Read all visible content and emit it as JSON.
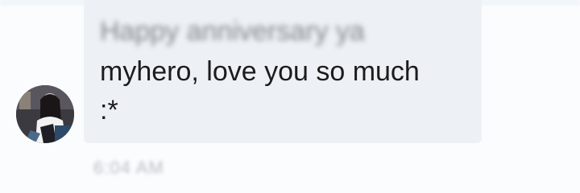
{
  "conversation": {
    "message": {
      "line1": "Happy anniversary ya",
      "line2": "myhero, love you so much",
      "line3": ":*",
      "timestamp": "6:04 AM"
    },
    "sender": {
      "avatar_icon": "profile-photo"
    }
  },
  "colors": {
    "bubble_bg": "#edf1f6",
    "text": "#1c1c1c",
    "timestamp": "#b9bec4"
  }
}
